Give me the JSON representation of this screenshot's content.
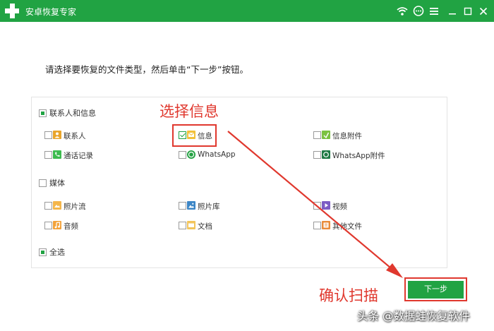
{
  "window": {
    "title": "安卓恢复专家",
    "accent_color": "#21a343",
    "icons": [
      "wifi-icon",
      "chat-icon",
      "menu-icon",
      "minimize-icon",
      "maximize-icon",
      "close-icon"
    ]
  },
  "instruction": "请选择要恢复的文件类型，然后单击“下一步”按钮。",
  "categories": {
    "contacts_messages": {
      "label": "联系人和信息",
      "state": "partial",
      "items": {
        "contacts": {
          "label": "联系人",
          "checked": false,
          "icon": "contacts-icon"
        },
        "messages": {
          "label": "信息",
          "checked": true,
          "icon": "message-icon"
        },
        "message_attachments": {
          "label": "信息附件",
          "checked": false,
          "icon": "attachment-icon"
        },
        "call_logs": {
          "label": "通话记录",
          "checked": false,
          "icon": "phone-icon"
        },
        "whatsapp": {
          "label": "WhatsApp",
          "checked": false,
          "icon": "whatsapp-icon"
        },
        "whatsapp_attachments": {
          "label": "WhatsApp附件",
          "checked": false,
          "icon": "whatsapp-attachment-icon"
        }
      }
    },
    "media": {
      "label": "媒体",
      "state": "unchecked",
      "items": {
        "photo_stream": {
          "label": "照片流",
          "checked": false,
          "icon": "photo-stream-icon"
        },
        "photo_library": {
          "label": "照片库",
          "checked": false,
          "icon": "photo-library-icon"
        },
        "video": {
          "label": "视频",
          "checked": false,
          "icon": "video-icon"
        },
        "audio": {
          "label": "音频",
          "checked": false,
          "icon": "audio-icon"
        },
        "documents": {
          "label": "文档",
          "checked": false,
          "icon": "document-icon"
        },
        "other_files": {
          "label": "其他文件",
          "checked": false,
          "icon": "other-files-icon"
        }
      }
    },
    "select_all": {
      "label": "全选",
      "state": "partial"
    }
  },
  "annotations": {
    "select_message": "选择信息",
    "confirm_scan": "确认扫描",
    "color": "#e0382e"
  },
  "next_button": "下一步",
  "watermark": "头条 @数据蛙恢复软件"
}
